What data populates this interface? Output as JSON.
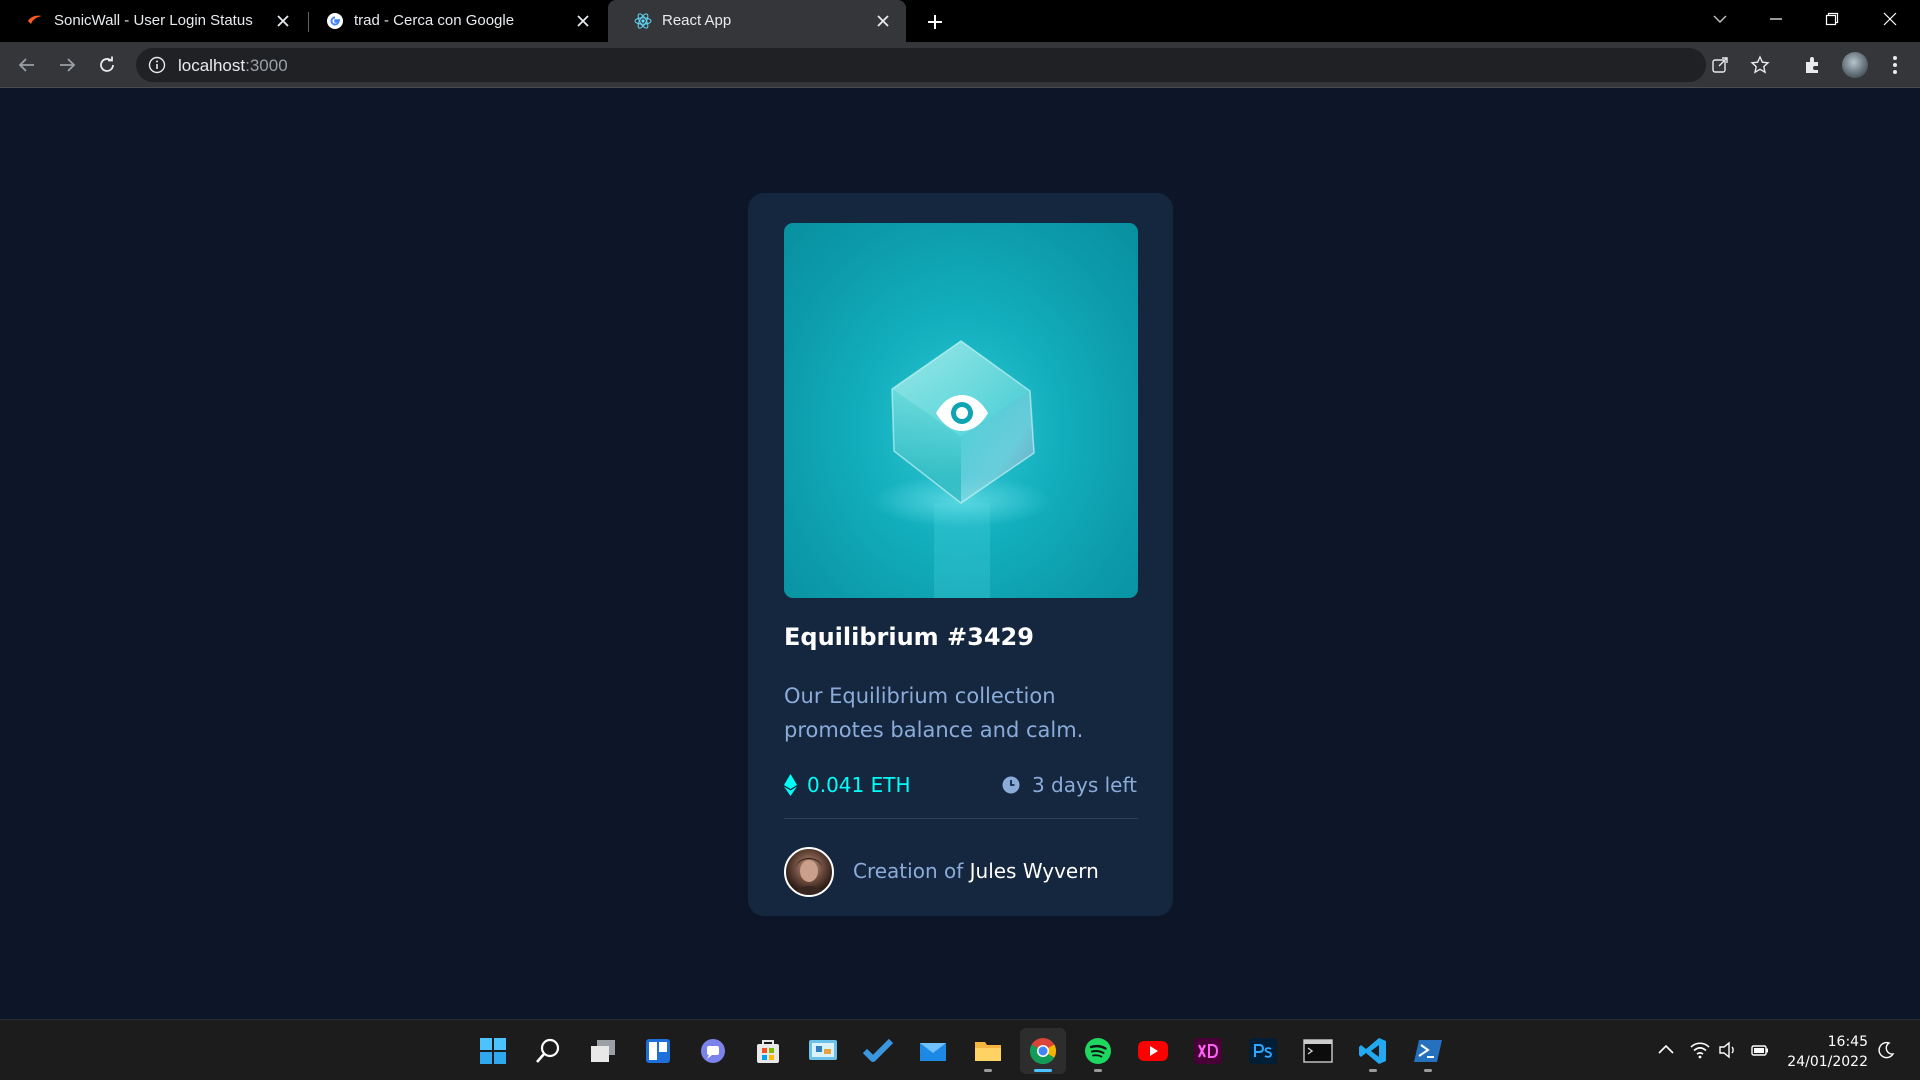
{
  "browser": {
    "tabs": [
      {
        "title": "SonicWall - User Login Status",
        "icon": "sonicwall-icon",
        "active": false
      },
      {
        "title": "trad - Cerca con Google",
        "icon": "google-icon",
        "active": false
      },
      {
        "title": "React App",
        "icon": "react-icon",
        "active": true
      }
    ],
    "url_host": "localhost",
    "url_port": ":3000"
  },
  "card": {
    "title": "Equilibrium #3429",
    "description": "Our Equilibrium collection promotes balance and calm.",
    "price": "0.041 ETH",
    "time_left": "3 days left",
    "creator_prefix": "Creation of",
    "creator_name": "Jules Wyvern",
    "colors": {
      "background": "#0d1629",
      "card": "#15263f",
      "cyan": "#00fff8",
      "soft_blue": "#8bacd9"
    }
  },
  "taskbar": {
    "apps": [
      "windows-start-icon",
      "search-icon",
      "task-view-icon",
      "widgets-icon",
      "teams-chat-icon",
      "store-icon",
      "control-panel-icon",
      "todo-icon",
      "mail-icon",
      "file-explorer-icon",
      "chrome-icon",
      "spotify-icon",
      "youtube-icon",
      "adobe-xd-icon",
      "photoshop-icon",
      "terminal-icon",
      "vscode-icon",
      "powershell-icon"
    ],
    "time": "16:45",
    "date": "24/01/2022"
  }
}
